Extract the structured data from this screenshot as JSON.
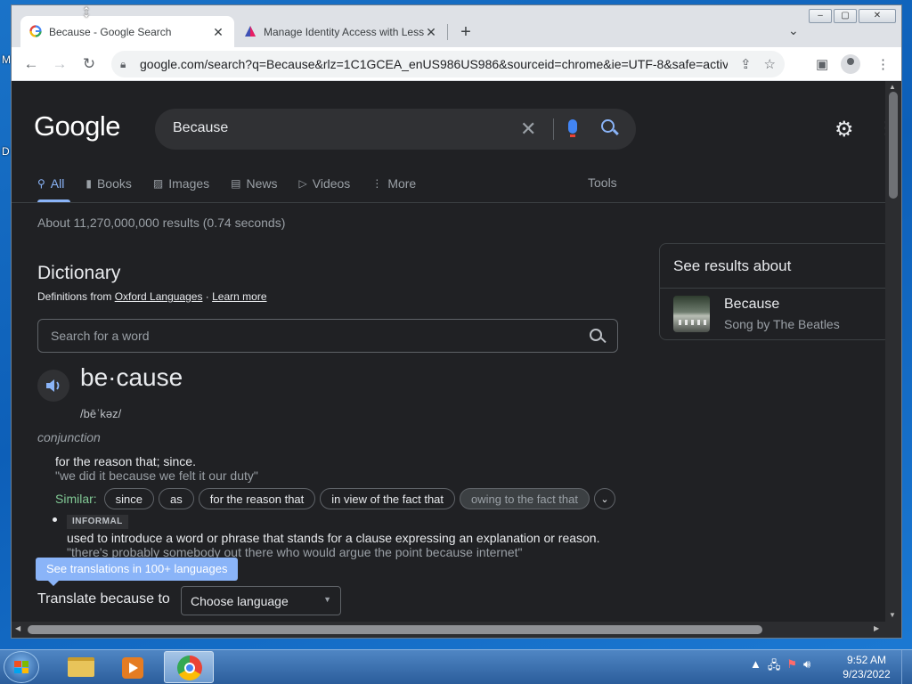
{
  "desktop": {
    "left_letters": [
      "M",
      "D"
    ]
  },
  "browser": {
    "tabs": [
      {
        "title": "Because - Google Search",
        "favicon": "google-g-icon",
        "active": true
      },
      {
        "title": "Manage Identity Access with Less",
        "favicon": "triangle-logo-icon",
        "active": false
      }
    ],
    "window_buttons": {
      "minimize": "–",
      "maximize": "▢",
      "close": "✕"
    },
    "url": "google.com/search?q=Because&rlz=1C1GCEA_enUS986US986&sourceid=chrome&ie=UTF-8&safe=active..."
  },
  "google": {
    "logo": "Google",
    "query": "Because",
    "nav_tabs": [
      {
        "label": "All",
        "icon": "search-icon",
        "active": true
      },
      {
        "label": "Books",
        "icon": "book-icon"
      },
      {
        "label": "Images",
        "icon": "image-icon"
      },
      {
        "label": "News",
        "icon": "news-icon"
      },
      {
        "label": "Videos",
        "icon": "video-icon"
      },
      {
        "label": "More",
        "icon": "more-dots-icon"
      }
    ],
    "tools": "Tools",
    "stats": "About 11,270,000,000 results (0.74 seconds)"
  },
  "dictionary": {
    "title": "Dictionary",
    "source_prefix": "Definitions from ",
    "source_link": "Oxford Languages",
    "separator": " · ",
    "learn_more": "Learn more",
    "search_placeholder": "Search for a word",
    "headword": "be·cause",
    "pronunciation": "/bēˈkəz/",
    "part_of_speech": "conjunction",
    "definition_1": "for the reason that; since.",
    "example_1": "\"we did it because we felt it our duty\"",
    "similar_label": "Similar:",
    "similar": [
      "since",
      "as",
      "for the reason that",
      "in view of the fact that",
      "owing to the fact that"
    ],
    "register": "INFORMAL",
    "definition_2": "used to introduce a word or phrase that stands for a clause expressing an explanation or reason.",
    "example_2": "\"there's probably somebody out there who would argue the point because internet\"",
    "tooltip": "See translations in 100+ languages",
    "translate_label": "Translate because to",
    "language_select": "Choose language"
  },
  "knowledge_panel": {
    "title": "See results about",
    "name": "Because",
    "description": "Song by The Beatles"
  },
  "taskbar": {
    "time": "9:52 AM",
    "date": "9/23/2022"
  }
}
